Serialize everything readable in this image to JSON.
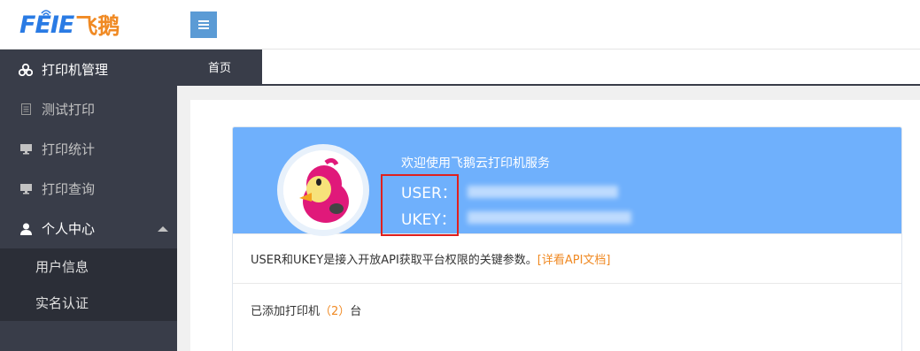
{
  "header": {
    "logo_en": "FEIE",
    "logo_cn": "飞鹅",
    "menu_toggle_icon": "hamburger-icon"
  },
  "sidebar": {
    "items": [
      {
        "label": "打印机管理",
        "icon": "cubes-icon"
      },
      {
        "label": "测试打印",
        "icon": "document-icon"
      },
      {
        "label": "打印统计",
        "icon": "monitor-icon"
      },
      {
        "label": "打印查询",
        "icon": "monitor-icon"
      },
      {
        "label": "个人中心",
        "icon": "user-icon"
      }
    ],
    "subitems": [
      {
        "label": "用户信息"
      },
      {
        "label": "实名认证"
      }
    ]
  },
  "tabs": [
    {
      "label": "首页",
      "active": true
    }
  ],
  "card": {
    "welcome": "欢迎使用飞鹅云打印机服务",
    "user_label": "USER：",
    "ukey_label": "UKEY：",
    "info_text": "USER和UKEY是接入开放API获取平台权限的关键参数。",
    "doc_link": "[详看API文档]",
    "printers_prefix": "已添加打印机",
    "printers_count": "（2）",
    "printers_suffix": "台"
  },
  "colors": {
    "brand_blue": "#2a7be4",
    "brand_orange": "#f08a24",
    "sidebar_bg": "#393d49",
    "card_head_bg": "#6fb0fc",
    "highlight_red": "#e0201e"
  }
}
